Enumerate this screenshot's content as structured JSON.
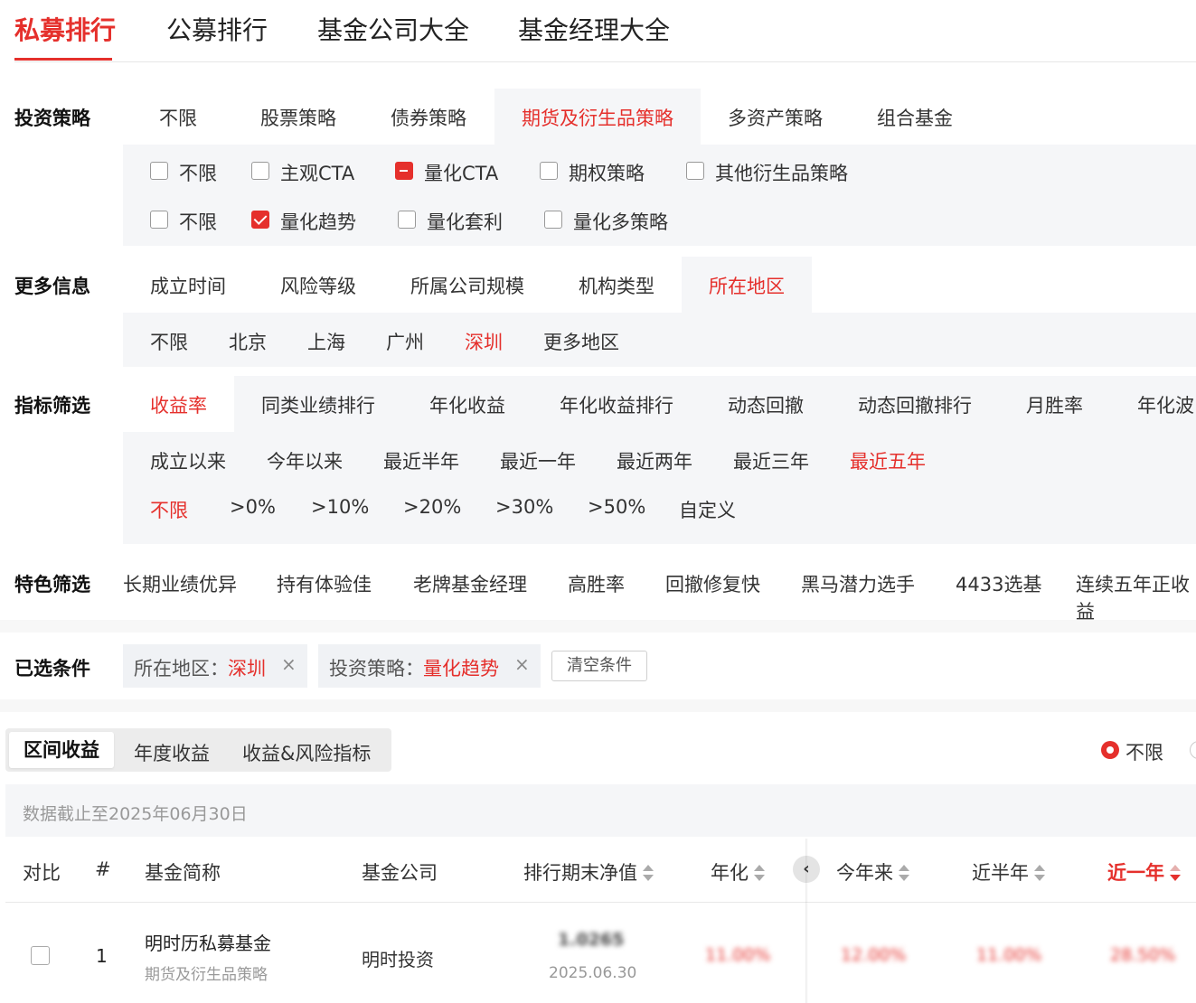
{
  "top_tabs": [
    "私募排行",
    "公募排行",
    "基金公司大全",
    "基金经理大全"
  ],
  "strategy": {
    "label": "投资策略",
    "tabs": [
      "不限",
      "股票策略",
      "债券策略",
      "期货及衍生品策略",
      "多资产策略",
      "组合基金"
    ],
    "row1": [
      "不限",
      "主观CTA",
      "量化CTA",
      "期权策略",
      "其他衍生品策略"
    ],
    "row2": [
      "不限",
      "量化趋势",
      "量化套利",
      "量化多策略"
    ]
  },
  "more_info": {
    "label": "更多信息",
    "tabs": [
      "成立时间",
      "风险等级",
      "所属公司规模",
      "机构类型",
      "所在地区"
    ],
    "regions": [
      "不限",
      "北京",
      "上海",
      "广州",
      "深圳",
      "更多地区"
    ]
  },
  "indicator": {
    "label": "指标筛选",
    "tabs": [
      "收益率",
      "同类业绩排行",
      "年化收益",
      "年化收益排行",
      "动态回撤",
      "动态回撤排行",
      "月胜率",
      "年化波"
    ],
    "periods": [
      "成立以来",
      "今年以来",
      "最近半年",
      "最近一年",
      "最近两年",
      "最近三年",
      "最近五年"
    ],
    "thresholds": [
      "不限",
      ">0%",
      ">10%",
      ">20%",
      ">30%",
      ">50%",
      "自定义"
    ]
  },
  "featured": {
    "label": "特色筛选",
    "items": [
      "长期业绩优异",
      "持有体验佳",
      "老牌基金经理",
      "高胜率",
      "回撤修复快",
      "黑马潜力选手",
      "4433选基",
      "连续五年正收益"
    ]
  },
  "selected": {
    "label": "已选条件",
    "chip1_key": "所在地区：",
    "chip1_val": "深圳",
    "chip2_key": "投资策略：",
    "chip2_val": "量化趋势",
    "close_glyph": "×",
    "clear": "清空条件"
  },
  "result_tabs": [
    "区间收益",
    "年度收益",
    "收益&风险指标"
  ],
  "radio_label": "不限",
  "date_note": "数据截止至2025年06月30日",
  "table": {
    "headers": [
      "对比",
      "#",
      "基金简称",
      "基金公司",
      "排行期末净值",
      "年化",
      "今年来",
      "近半年",
      "近一年"
    ],
    "rows": [
      {
        "rank": "1",
        "name": "明时历私募基金",
        "type": "期货及衍生品策略",
        "company": "明时投资",
        "nav": "1.0265",
        "nav_date": "2025.06.30",
        "annual": "11.00%",
        "ytd": "12.00%",
        "half": "11.00%",
        "year": "28.50%"
      }
    ]
  },
  "colors": {
    "accent": "#e5302c",
    "panel": "#f5f6f8"
  }
}
